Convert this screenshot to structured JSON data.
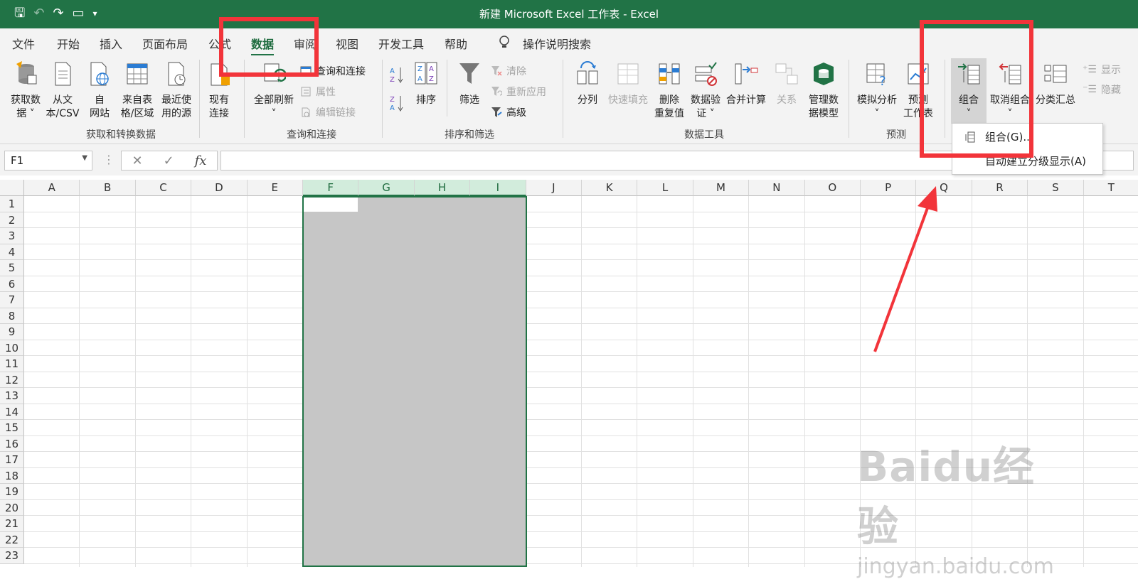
{
  "window": {
    "title": "新建 Microsoft Excel 工作表  -  Excel"
  },
  "tabs": [
    "文件",
    "开始",
    "插入",
    "页面布局",
    "公式",
    "数据",
    "审阅",
    "视图",
    "开发工具",
    "帮助",
    "操作说明搜索"
  ],
  "active_tab": "数据",
  "ribbon": {
    "groups": {
      "get_transform": "获取和转换数据",
      "query_connections": "查询和连接",
      "sort_filter": "排序和筛选",
      "data_tools": "数据工具",
      "forecast": "预测"
    },
    "buttons": {
      "get_data": [
        "获取数",
        "据 ˅"
      ],
      "from_csv": [
        "从文",
        "本/CSV"
      ],
      "from_web": [
        "自",
        "网站"
      ],
      "from_table": [
        "来自表",
        "格/区域"
      ],
      "recent_sources": [
        "最近使",
        "用的源"
      ],
      "existing_connections": [
        "现有",
        "连接"
      ],
      "refresh_all": [
        "全部刷新",
        "˅"
      ],
      "queries_connections": "查询和连接",
      "properties": "属性",
      "edit_links": "编辑链接",
      "sort": "排序",
      "filter": "筛选",
      "clear": "清除",
      "reapply": "重新应用",
      "advanced": "高级",
      "text_to_columns": "分列",
      "flash_fill": "快速填充",
      "remove_duplicates": [
        "删除",
        "重复值"
      ],
      "data_validation": [
        "数据验",
        "证 ˅"
      ],
      "consolidate": "合并计算",
      "relationships": "关系",
      "manage_data_model": [
        "管理数",
        "据模型"
      ],
      "what_if": [
        "模拟分析",
        "˅"
      ],
      "forecast_sheet": [
        "预测",
        "工作表"
      ],
      "group": [
        "组合",
        "˅"
      ],
      "ungroup": [
        "取消组合",
        "˅"
      ],
      "subtotal": "分类汇总",
      "show_detail": "显示",
      "hide_detail": "隐藏"
    }
  },
  "formula_bar": {
    "name_box": "F1",
    "fx": "fx",
    "value": ""
  },
  "columns": [
    "A",
    "B",
    "C",
    "D",
    "E",
    "F",
    "G",
    "H",
    "I",
    "J",
    "K",
    "L",
    "M",
    "N",
    "O",
    "P",
    "Q",
    "R",
    "S",
    "T"
  ],
  "selected_columns": [
    "F",
    "G",
    "H",
    "I"
  ],
  "rows": [
    "1",
    "2",
    "3",
    "4",
    "5",
    "6",
    "7",
    "8",
    "9",
    "10",
    "11",
    "12",
    "13",
    "14",
    "15",
    "16",
    "17",
    "18",
    "19",
    "20",
    "21",
    "22",
    "23"
  ],
  "group_menu": {
    "items": [
      "组合(G)...",
      "自动建立分级显示(A)"
    ]
  },
  "watermark": {
    "logo": "Baidu经验",
    "url": "jingyan.baidu.com"
  },
  "colors": {
    "excel_green": "#217346",
    "selection_gray": "#c6c6c6",
    "annotation_red": "#f2343a"
  }
}
